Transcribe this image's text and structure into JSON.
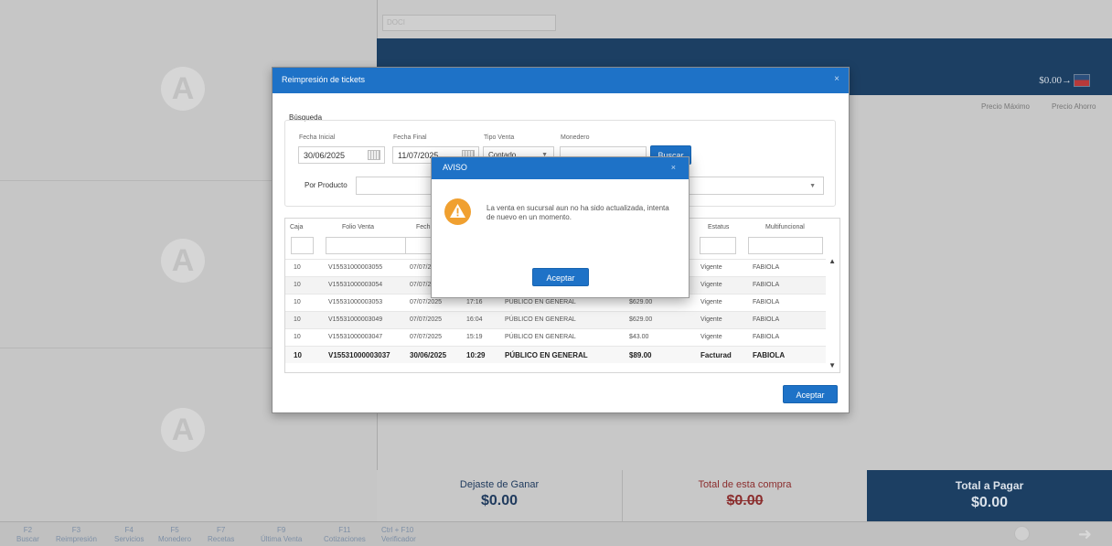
{
  "background": {
    "search_placeholder": "DOCI",
    "band_amount": "$0.00",
    "band_arrow": "→",
    "header_cols": [
      "Precio Máximo",
      "Precio Ahorro"
    ],
    "dejaste": {
      "label": "Dejaste de Ganar",
      "value": "$0.00"
    },
    "total_compra": {
      "label": "Total de esta compra",
      "value": "$0.00"
    },
    "total_pagar": {
      "label": "Total a Pagar",
      "value": "$0.00"
    },
    "logo_letter": "A"
  },
  "footer": {
    "keys": [
      {
        "key": "F2",
        "label": "Buscar"
      },
      {
        "key": "F3",
        "label": "Reimpresión"
      },
      {
        "key": "F4",
        "label": "Servicios"
      },
      {
        "key": "F5",
        "label": "Monedero"
      },
      {
        "key": "F7",
        "label": "Recetas"
      },
      {
        "key": "F9",
        "label": "Última Venta"
      },
      {
        "key": "F11",
        "label": "Cotizaciones"
      },
      {
        "key": "Ctrl + F10",
        "label": "Verificador"
      }
    ]
  },
  "modal": {
    "title": "Reimpresión de tickets",
    "close": "×",
    "busqueda": "Búsqueda",
    "fecha_inicial_label": "Fecha Inicial",
    "fecha_inicial": "30/06/2025",
    "fecha_final_label": "Fecha Final",
    "fecha_final": "11/07/2025",
    "tipo_venta_label": "Tipo Venta",
    "tipo_venta": "Contado",
    "monedero_label": "Monedero",
    "monedero": "",
    "buscar": "Buscar",
    "por_producto": "Por Producto",
    "columns": {
      "caja": "Caja",
      "folio": "Folio Venta",
      "fecha": "Fech",
      "estatus": "Estatus",
      "multifuncional": "Multifuncional"
    },
    "rows": [
      {
        "caja": "10",
        "folio": "V15531000003055",
        "fecha": "07/07/2",
        "hora": "",
        "cliente": "",
        "total": "",
        "estatus": "Vigente",
        "multi": "FABIOLA"
      },
      {
        "caja": "10",
        "folio": "V15531000003054",
        "fecha": "07/07/2",
        "hora": "",
        "cliente": "",
        "total": "",
        "estatus": "Vigente",
        "multi": "FABIOLA"
      },
      {
        "caja": "10",
        "folio": "V15531000003053",
        "fecha": "07/07/2025",
        "hora": "17:16",
        "cliente": "PÚBLICO EN GENERAL",
        "total": "$629.00",
        "estatus": "Vigente",
        "multi": "FABIOLA"
      },
      {
        "caja": "10",
        "folio": "V15531000003049",
        "fecha": "07/07/2025",
        "hora": "16:04",
        "cliente": "PÚBLICO EN GENERAL",
        "total": "$629.00",
        "estatus": "Vigente",
        "multi": "FABIOLA"
      },
      {
        "caja": "10",
        "folio": "V15531000003047",
        "fecha": "07/07/2025",
        "hora": "15:19",
        "cliente": "PÚBLICO EN GENERAL",
        "total": "$43.00",
        "estatus": "Vigente",
        "multi": "FABIOLA"
      },
      {
        "caja": "10",
        "folio": "V15531000003037",
        "fecha": "30/06/2025",
        "hora": "10:29",
        "cliente": "PÚBLICO EN GENERAL",
        "total": "$89.00",
        "estatus": "Facturad",
        "multi": "FABIOLA"
      }
    ],
    "aceptar": "Aceptar"
  },
  "aviso": {
    "title": "AVISO",
    "close": "×",
    "message": "La venta en sucursal aun no ha sido actualizada, intenta de nuevo en un momento.",
    "aceptar": "Aceptar"
  },
  "colors": {
    "primary": "#1e72c7",
    "navy": "#1c3f63",
    "warning": "#f0a030"
  }
}
